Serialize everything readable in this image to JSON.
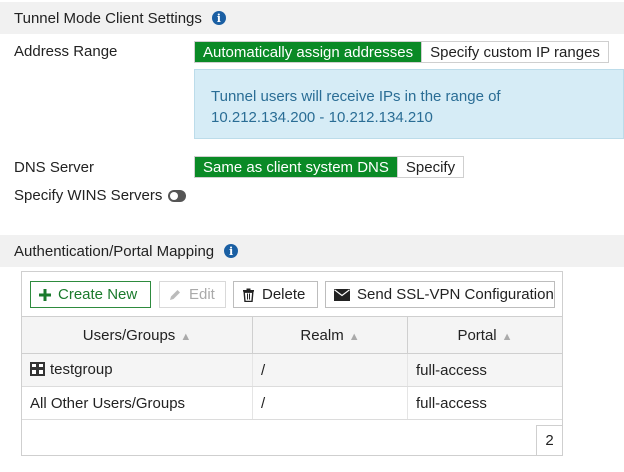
{
  "tunnel_section": {
    "title": "Tunnel Mode Client Settings",
    "address_range": {
      "label": "Address Range",
      "options": [
        "Automatically assign addresses",
        "Specify custom IP ranges"
      ],
      "selected": "Automatically assign addresses",
      "info": "Tunnel users will receive IPs in the range of 10.212.134.200 - 10.212.134.210"
    },
    "dns_server": {
      "label": "DNS Server",
      "options": [
        "Same as client system DNS",
        "Specify"
      ],
      "selected": "Same as client system DNS"
    },
    "wins": {
      "label": "Specify WINS Servers",
      "enabled": false
    }
  },
  "auth_section": {
    "title": "Authentication/Portal Mapping",
    "toolbar": {
      "create_new": "Create New",
      "edit": "Edit",
      "delete": "Delete",
      "send_config": "Send SSL-VPN Configuration"
    },
    "columns": [
      "Users/Groups",
      "Realm",
      "Portal"
    ],
    "rows": [
      {
        "users_groups": "testgroup",
        "realm": "/",
        "portal": "full-access",
        "icon": "group-icon"
      },
      {
        "users_groups": "All Other Users/Groups",
        "realm": "/",
        "portal": "full-access"
      }
    ],
    "total": "2"
  },
  "colors": {
    "active_green": "#0a8a26",
    "info_bg": "#d6ecf6",
    "info_text": "#2a6d95"
  }
}
